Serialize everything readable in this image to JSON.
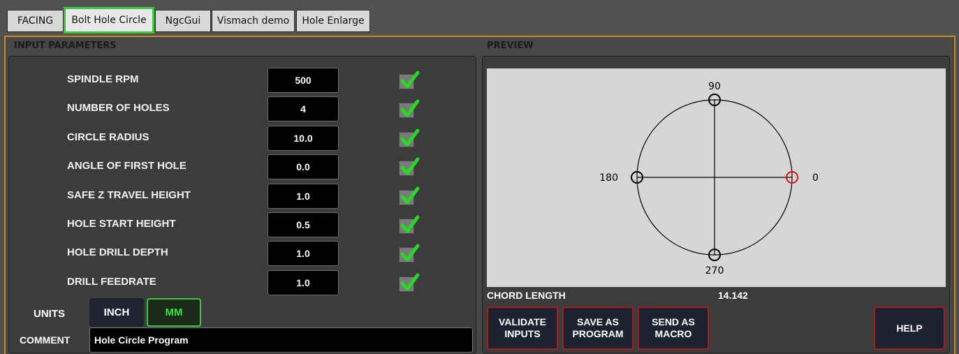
{
  "tabs": [
    {
      "label": "FACING"
    },
    {
      "label": "Bolt Hole Circle"
    },
    {
      "label": "NgcGui"
    },
    {
      "label": "Vismach demo"
    },
    {
      "label": "Hole Enlarge"
    }
  ],
  "input_section": {
    "title": "INPUT PARAMETERS"
  },
  "preview_section": {
    "title": "PREVIEW"
  },
  "params": [
    {
      "label": "SPINDLE RPM",
      "value": "500"
    },
    {
      "label": "NUMBER OF HOLES",
      "value": "4"
    },
    {
      "label": "CIRCLE RADIUS",
      "value": "10.0"
    },
    {
      "label": "ANGLE OF FIRST HOLE",
      "value": "0.0"
    },
    {
      "label": "SAFE Z TRAVEL HEIGHT",
      "value": "1.0"
    },
    {
      "label": "HOLE START HEIGHT",
      "value": "0.5"
    },
    {
      "label": "HOLE DRILL DEPTH",
      "value": "1.0"
    },
    {
      "label": "DRILL FEEDRATE",
      "value": "1.0"
    }
  ],
  "units": {
    "label": "UNITS",
    "inch": "INCH",
    "mm": "MM",
    "selected": "MM"
  },
  "comment": {
    "label": "COMMENT",
    "value": "Hole Circle Program"
  },
  "preview": {
    "angle_labels": {
      "a90": "90",
      "a180": "180",
      "a0": "0",
      "a270": "270"
    },
    "first_hole_color": "#e01010"
  },
  "chord": {
    "label": "CHORD LENGTH",
    "value": "14.142"
  },
  "buttons": {
    "validate": "VALIDATE\nINPUTS",
    "save": "SAVE AS\nPROGRAM",
    "send": "SEND AS\nMACRO",
    "help": "HELP"
  },
  "colors": {
    "accent_border": "#c98e1f",
    "valid_green": "#3ec53e",
    "button_red": "#a81b1b"
  }
}
